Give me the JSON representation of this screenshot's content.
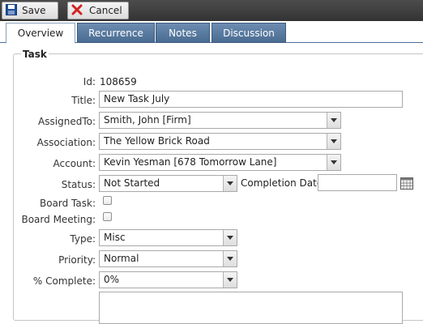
{
  "toolbar": {
    "save_label": "Save",
    "cancel_label": "Cancel"
  },
  "tabs": {
    "overview": "Overview",
    "recurrence": "Recurrence",
    "notes": "Notes",
    "discussion": "Discussion"
  },
  "section": {
    "legend": "Task"
  },
  "labels": {
    "id": "Id:",
    "title": "Title:",
    "assigned_to": "AssignedTo:",
    "association": "Association:",
    "account": "Account:",
    "status": "Status:",
    "completion_date": "Completion Date:",
    "board_task": "Board Task:",
    "board_meeting": "Board Meeting:",
    "type": "Type:",
    "priority": "Priority:",
    "percent_complete": "% Complete:"
  },
  "fields": {
    "id": "108659",
    "title": "New Task July",
    "assigned_to": "Smith, John [Firm]",
    "association": "The Yellow Brick Road",
    "account": "Kevin Yesman [678 Tomorrow Lane]",
    "status": "Not Started",
    "completion_date": "",
    "board_task": false,
    "board_meeting": false,
    "type": "Misc",
    "priority": "Normal",
    "percent_complete": "0%",
    "description": ""
  },
  "colors": {
    "tab_inactive": "#5a7ca3",
    "toolbar": "#3c3c3c",
    "cancel_red": "#d42020",
    "save_blue": "#1e4f9c"
  }
}
